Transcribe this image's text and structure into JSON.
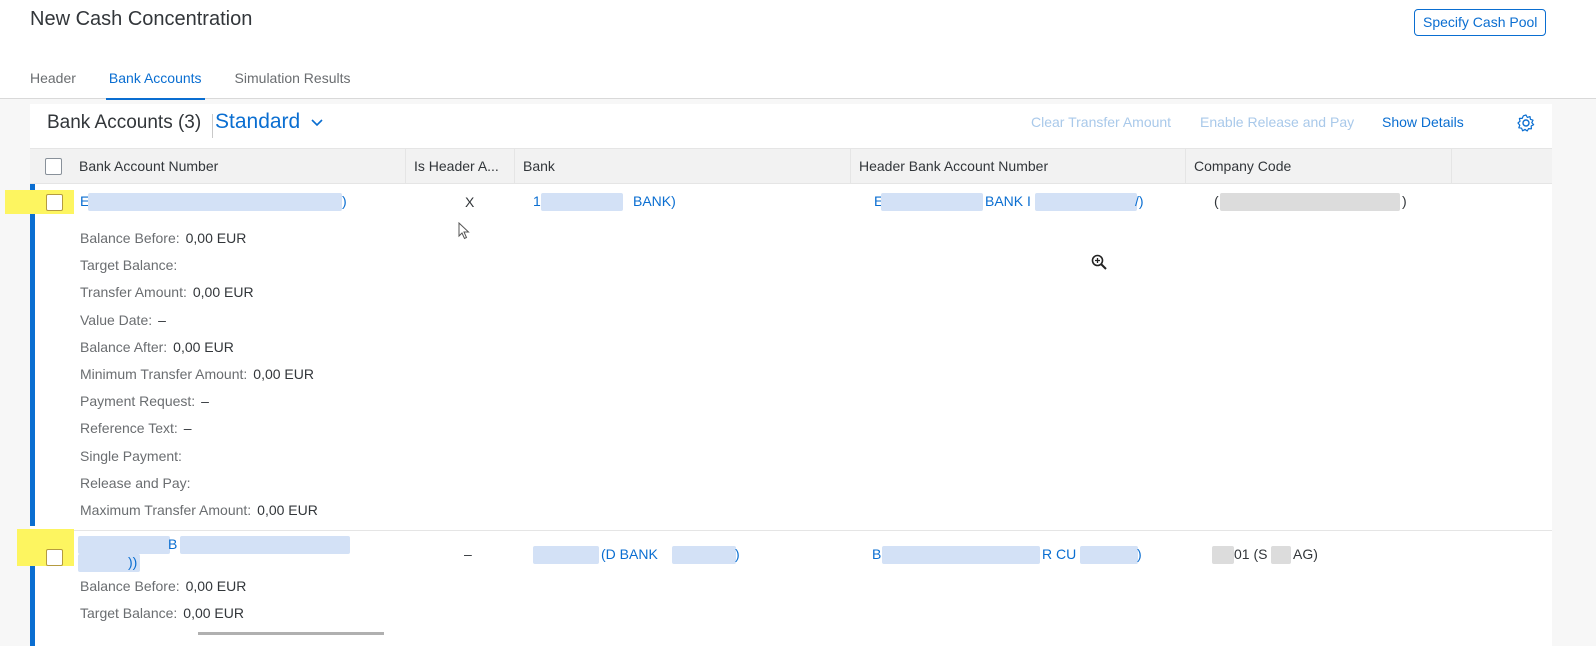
{
  "header": {
    "title": "New Cash Concentration",
    "specify_cash_pool": "Specify Cash Pool",
    "tabs": [
      {
        "label": "Header"
      },
      {
        "label": "Bank Accounts"
      },
      {
        "label": "Simulation Results"
      }
    ]
  },
  "toolbar": {
    "title": "Bank Accounts (3)",
    "variant": "Standard",
    "clear_transfer": "Clear Transfer Amount",
    "enable_release": "Enable Release and Pay",
    "show_details": "Show Details"
  },
  "table": {
    "columns": [
      "Bank Account Number",
      "Is Header A...",
      "Bank",
      "Header Bank Account Number",
      "Company Code"
    ],
    "rows": [
      {
        "account_start": "E",
        "account_end": ")",
        "is_header": "X",
        "bank_start": "1",
        "bank_end": "BANK)",
        "header_acct_start": "E",
        "header_acct_mid": "BANK I",
        "header_acct_end": "/)",
        "company_start": "(",
        "company_end": ")",
        "details": [
          {
            "label": "Balance Before:",
            "value": "0,00  EUR"
          },
          {
            "label": "Target Balance:",
            "value": ""
          },
          {
            "label": "Transfer Amount:",
            "value": "0,00  EUR"
          },
          {
            "label": "Value Date:",
            "value": "–"
          },
          {
            "label": "Balance After:",
            "value": "0,00  EUR"
          },
          {
            "label": "Minimum Transfer Amount:",
            "value": "0,00  EUR"
          },
          {
            "label": "Payment Request:",
            "value": "–"
          },
          {
            "label": "Reference Text:",
            "value": "–"
          },
          {
            "label": "Single Payment:",
            "value": ""
          },
          {
            "label": "Release and Pay:",
            "value": ""
          },
          {
            "label": "Maximum Transfer Amount:",
            "value": "0,00  EUR"
          }
        ]
      },
      {
        "account_mid": "B",
        "account_line2": "))",
        "is_header": "–",
        "bank_mid": "(D BANK",
        "bank_end": ")",
        "header_acct_start": "B",
        "header_acct_mid": "R CU",
        "header_acct_end": ")",
        "company_mid": "01 (S",
        "company_end": "AG)",
        "details": [
          {
            "label": "Balance Before:",
            "value": "0,00  EUR"
          },
          {
            "label": "Target Balance:",
            "value": "0,00  EUR"
          }
        ]
      }
    ]
  },
  "icons": {
    "variant_chevron": "chevron-down-icon",
    "settings": "gear-icon",
    "zoom": "zoom-in-icon",
    "cursor": "mouse-pointer-icon"
  },
  "colors": {
    "accent": "#0a6ed1",
    "highlight": "#fdf560",
    "disabled": "#a9c9ea"
  }
}
